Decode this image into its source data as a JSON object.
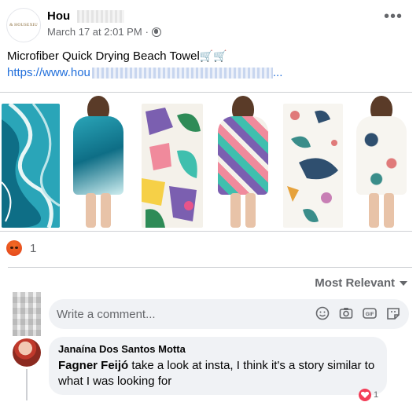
{
  "header": {
    "page_name": "Hou",
    "logo_text": "& HOUSEXIU",
    "timestamp": "March 17 at 2:01 PM",
    "separator": "·",
    "more_label": "•••"
  },
  "post": {
    "text": "Microfiber Quick Drying Beach Towel",
    "emoji": "🛒🛒",
    "link_visible": "https://www.hou",
    "link_suffix": "..."
  },
  "gallery": {
    "items": [
      {
        "kind": "towel",
        "pattern": "blue-marble"
      },
      {
        "kind": "model",
        "pattern": "blue-marble"
      },
      {
        "kind": "towel",
        "pattern": "tropical-leaves"
      },
      {
        "kind": "model",
        "pattern": "tropical-leaves"
      },
      {
        "kind": "towel",
        "pattern": "sea-life"
      },
      {
        "kind": "model",
        "pattern": "sea-life"
      }
    ]
  },
  "reactions": {
    "icon": "angry-icon",
    "count": "1"
  },
  "comments": {
    "sort_label": "Most Relevant",
    "input_placeholder": "Write a comment...",
    "input_icons": [
      "emoji-icon",
      "camera-icon",
      "gif-icon",
      "sticker-icon"
    ],
    "gif_label": "GIF",
    "items": [
      {
        "author": "Janaína Dos Santos Motta",
        "mention": "Fagner Feijó",
        "text": " take a look at insta, I think it's a story similar to what I was looking for",
        "reaction_count": "1"
      }
    ]
  },
  "colors": {
    "link": "#216fdb",
    "muted": "#65676b",
    "bubble": "#f0f2f5",
    "angry": "#e3421c",
    "love": "#f33e58"
  }
}
